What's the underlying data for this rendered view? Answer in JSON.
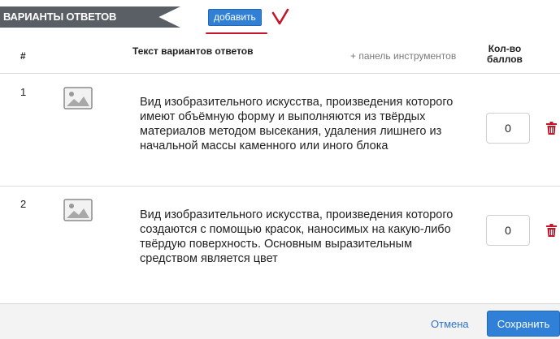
{
  "section": {
    "title": "ВАРИАНТЫ ОТВЕТОВ",
    "add_label": "добавить"
  },
  "table": {
    "headers": {
      "number": "#",
      "text": "Текст вариантов ответов",
      "toolbar_link": "+ панель инструментов",
      "score_line1": "Кол-во",
      "score_line2": "баллов"
    },
    "rows": [
      {
        "number": "1",
        "text": "Вид изобразительного искусства, произведения которого имеют объёмную форму и выполняются из твёрдых материалов методом высекания, удаления лишнего из начальной массы каменного или иного блока",
        "score": "0"
      },
      {
        "number": "2",
        "text": "Вид изобразительного искусства, произведения которого создаются с помощью красок, наносимых на какую-либо твёрдую поверхность. Основным выразительным средством является цвет",
        "score": "0"
      }
    ]
  },
  "footer": {
    "cancel_label": "Отмена",
    "save_label": "Сохранить"
  },
  "icons": {
    "row_image": "image-placeholder-icon",
    "row_delete": "trash-icon"
  },
  "colors": {
    "accent": "#2f80d6",
    "banner": "#5a5f66",
    "delete": "#c4162a",
    "annotation": "#c4162a"
  }
}
